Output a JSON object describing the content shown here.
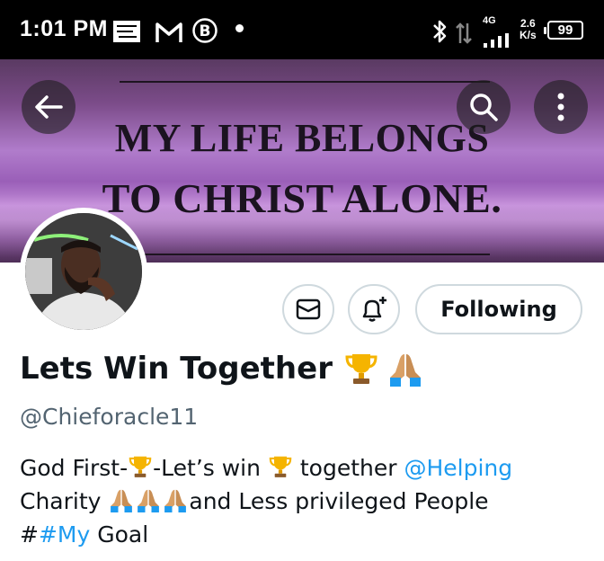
{
  "status_bar": {
    "time": "1:01 PM",
    "network_type": "4G",
    "speed_value": "2.6",
    "speed_unit": "K/s",
    "battery": "99"
  },
  "banner": {
    "line1": "MY LIFE BELONGS",
    "line2": "TO CHRIST ALONE.",
    "colors": {
      "primary": "#9a5fb8",
      "text": "#1b1320"
    }
  },
  "profile": {
    "display_name": "Lets Win Together",
    "handle": "@Chieforacle11",
    "following_label": "Following",
    "bio": {
      "part1": "God First-",
      "part2": "-Let’s win ",
      "part3": " together ",
      "mention": "@Helping",
      "part4": "Charity ",
      "part5": "and Less privileged People",
      "hash_prefix": "#",
      "hashtag": "#My",
      "part6": " Goal"
    }
  },
  "icons": [
    "back-arrow-icon",
    "search-icon",
    "more-options-icon",
    "message-icon",
    "bell-plus-icon",
    "trophy-icon",
    "praying-hands-icon"
  ],
  "theme": {
    "link_color": "#1d9bf0",
    "secondary_text": "#536471",
    "border": "#cfd9de"
  }
}
